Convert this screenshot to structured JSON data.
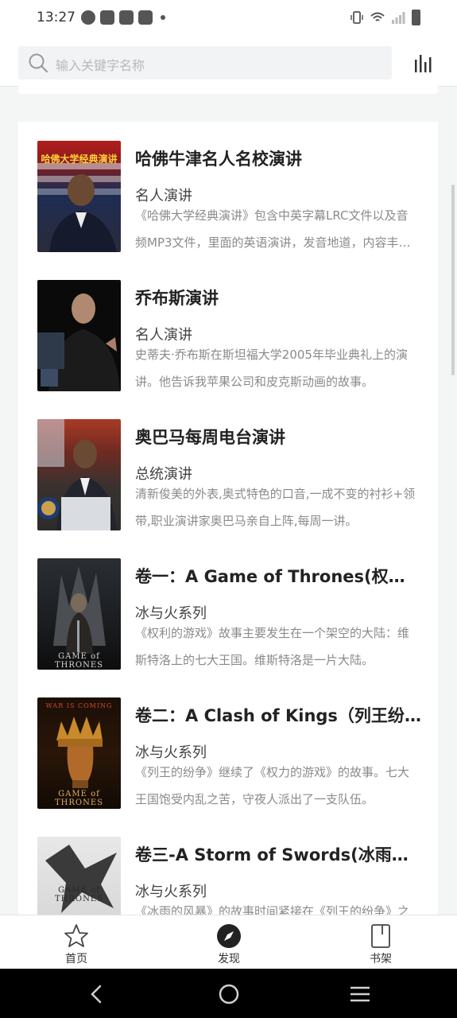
{
  "status": {
    "time": "13:27",
    "icons": [
      "app-icon",
      "mail-icon",
      "mail-icon",
      "mail-icon",
      "dot-icon"
    ],
    "right_icons": [
      "vibrate-icon",
      "wifi-icon",
      "signal-icon",
      "battery-icon"
    ]
  },
  "search": {
    "placeholder": "输入关键字名称"
  },
  "items": [
    {
      "title": "哈佛牛津名人名校演讲",
      "category": "名人演讲",
      "desc": "《哈佛大学经典演讲》包含中英字幕LRC文件以及音频MP3文件，里面的英语演讲，发音地道，内容丰富。",
      "cover_text": "哈佛大学经典演讲"
    },
    {
      "title": "乔布斯演讲",
      "category": "名人演讲",
      "desc": "史蒂夫·乔布斯在斯坦福大学2005年毕业典礼上的演讲。他告诉我苹果公司和皮克斯动画的故事。",
      "cover_text": ""
    },
    {
      "title": "奥巴马每周电台演讲",
      "category": "总统演讲",
      "desc": "清新俊美的外表,奥式特色的口音,一成不变的衬衫+领带,职业演讲家奥巴马亲自上阵,每周一讲。",
      "cover_text": ""
    },
    {
      "title": "卷一：A Game of Thrones(权利的游戏)",
      "category": "冰与火系列",
      "desc": "《权利的游戏》故事主要发生在一个架空的大陆：维斯特洛上的七大王国。维斯特洛是一片大陆。",
      "cover_text": "GAME of THRONES"
    },
    {
      "title": "卷二：A Clash of Kings（列王纷争）",
      "category": "冰与火系列",
      "desc": "《列王的纷争》继续了《权力的游戏》的故事。七大王国饱受内乱之苦，守夜人派出了一支队伍。",
      "cover_text": "GAME of THRONES",
      "cover_top": "WAR IS COMING"
    },
    {
      "title": "卷三-A Storm of Swords(冰雨的风暴)",
      "category": "冰与火系列",
      "desc": "《冰雨的风暴》的故事时间紧接在《列王的纷争》之后。",
      "cover_text": "GAME of THRONES"
    }
  ],
  "nav": {
    "home": "首页",
    "discover": "发现",
    "shelf": "书架"
  },
  "colors": {
    "background": "#f4f6f6",
    "card": "#ffffff",
    "title": "#222222",
    "desc": "#8a8a8a"
  }
}
